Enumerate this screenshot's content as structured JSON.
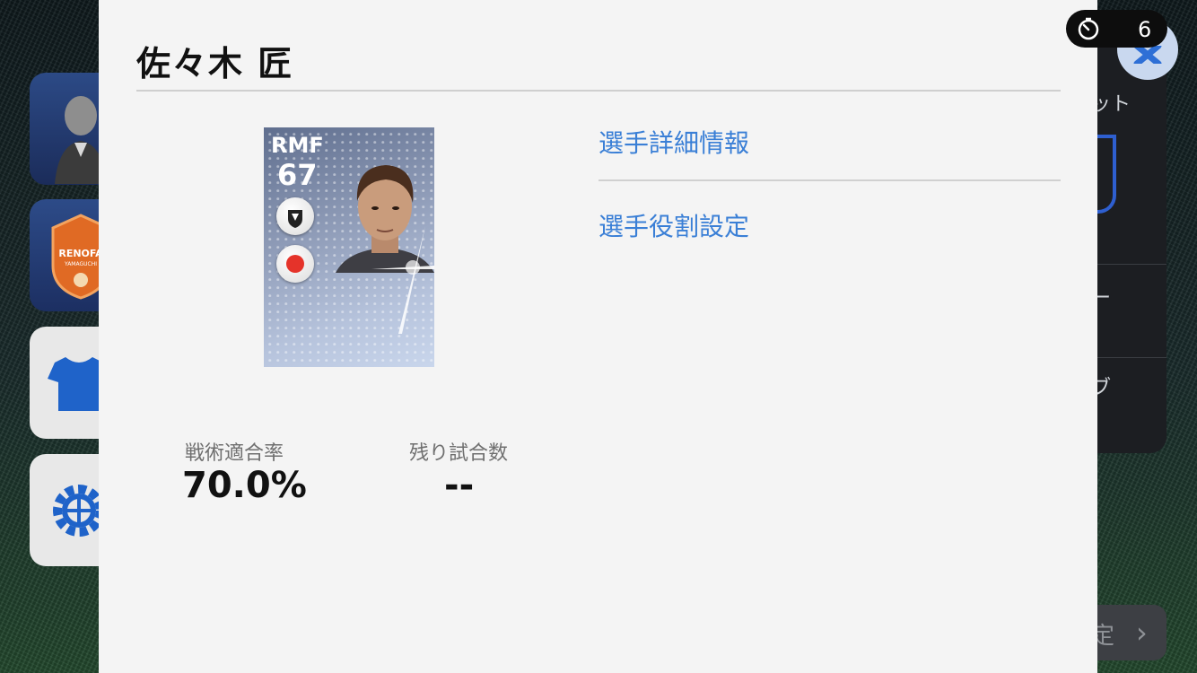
{
  "player": {
    "name": "佐々木 匠",
    "position": "RMF",
    "rating": "67"
  },
  "actions": {
    "details_label": "選手詳細情報",
    "role_label": "選手役割設定"
  },
  "stats": {
    "tactic_fit_label": "戦術適合率",
    "tactic_fit_value": "70.0%",
    "remaining_matches_label": "残り試合数",
    "remaining_matches_value": "--"
  },
  "timer": {
    "count": "6"
  },
  "background_menu": {
    "crest_text": "RENOFA",
    "crest_subtext": "YAMAGUCHI",
    "right_items": [
      "ット",
      "ー",
      "ブ"
    ],
    "confirm_label": "定"
  },
  "colors": {
    "link": "#3a7fd6",
    "panel": "#f4f4f4",
    "accent_blue": "#2e5fd0"
  }
}
